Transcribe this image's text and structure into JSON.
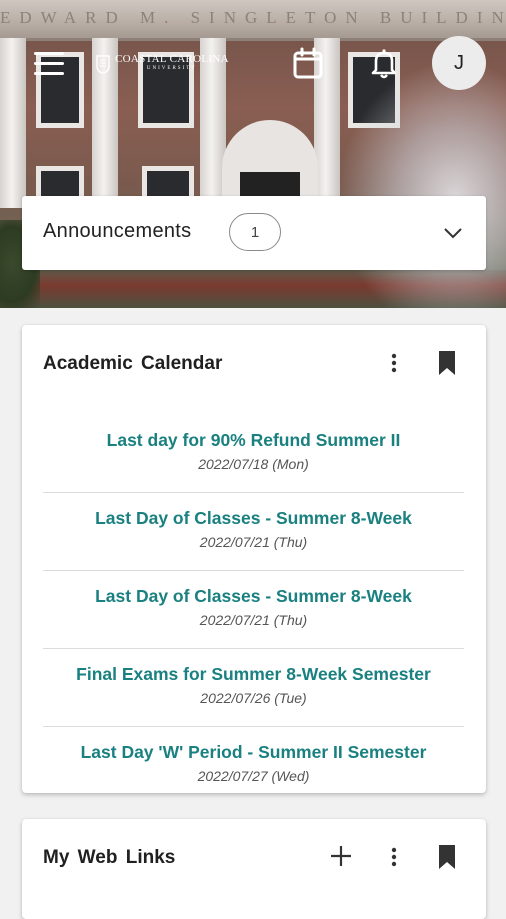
{
  "header": {
    "banner_text": "EDWARD M. SINGLETON BUILDING",
    "logo_text": "COASTAL CAROLINA",
    "logo_subtext": "UNIVERSITY",
    "avatar_initial": "J",
    "icons": [
      "menu-icon",
      "calendar-icon",
      "bell-icon"
    ]
  },
  "announcements": {
    "label": "Announcements",
    "count": "1"
  },
  "academic_calendar": {
    "title": "Academic Calendar",
    "events": [
      {
        "title": "Last day for 90% Refund Summer II",
        "date": "2022/07/18",
        "day": "(Mon)"
      },
      {
        "title": "Last Day of Classes - Summer 8-Week",
        "date": "2022/07/21",
        "day": "(Thu)"
      },
      {
        "title": "Last Day of Classes - Summer 8-Week",
        "date": "2022/07/21",
        "day": "(Thu)"
      },
      {
        "title": "Final Exams for Summer 8-Week Semester",
        "date": "2022/07/26",
        "day": "(Tue)"
      },
      {
        "title": "Last Day 'W' Period - Summer II Semester",
        "date": "2022/07/27",
        "day": "(Wed)"
      }
    ]
  },
  "web_links": {
    "title": "My Web Links"
  },
  "colors": {
    "accent_teal": "#1a8080",
    "card_bg": "#ffffff",
    "page_bg": "#f1f1f1"
  }
}
